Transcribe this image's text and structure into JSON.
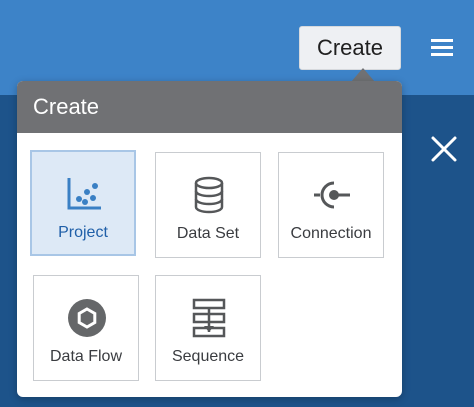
{
  "header": {
    "create_button_label": "Create",
    "menu_icon": "hamburger-menu-icon",
    "close_icon": "close-icon"
  },
  "popover": {
    "title": "Create",
    "tiles": [
      {
        "label": "Project",
        "icon": "scatter-chart-icon",
        "selected": true
      },
      {
        "label": "Data Set",
        "icon": "database-icon",
        "selected": false
      },
      {
        "label": "Connection",
        "icon": "connection-plug-icon",
        "selected": false
      },
      {
        "label": "Data Flow",
        "icon": "hexagon-flow-icon",
        "selected": false
      },
      {
        "label": "Sequence",
        "icon": "sequence-icon",
        "selected": false
      }
    ]
  },
  "colors": {
    "app_bar": "#3d83c8",
    "backdrop": "#1d538a",
    "popover_header": "#707174",
    "selected_tile_bg": "#dde9f6",
    "selected_tile_border": "#a8c6e6",
    "selected_label": "#1f5fa8"
  }
}
